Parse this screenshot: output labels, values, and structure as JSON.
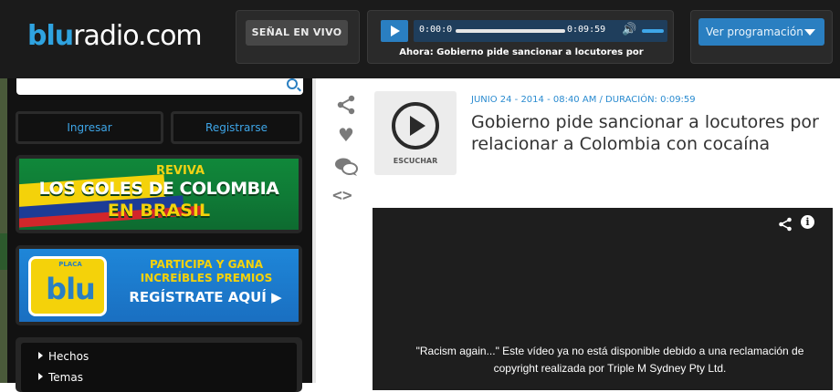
{
  "header": {
    "logo_prefix": "blu",
    "logo_suffix": "radio.com",
    "live_label": "SEÑAL EN VIVO",
    "programming_label": "Ver programación"
  },
  "player": {
    "current_time": "0:00:0",
    "duration": "0:09:59",
    "now_playing": "Ahora: Gobierno pide sancionar a locutores por"
  },
  "sidebar": {
    "login_label": "Ingresar",
    "register_label": "Registrarse",
    "banner1": {
      "line1": "REVIVA",
      "line2": "LOS GOLES DE COLOMBIA",
      "line3": "EN BRASIL"
    },
    "banner2": {
      "badge_top": "PLACA",
      "badge_text": "blu",
      "line1": "PARTICIPA Y GANA",
      "line2": "INCREÍBLES PREMIOS",
      "line3": "REGÍSTRATE AQUÍ ▶"
    },
    "nav": [
      "Hechos",
      "Temas"
    ]
  },
  "article": {
    "listen_label": "ESCUCHAR",
    "meta": "JUNIO 24 - 2014 - 08:40 AM / DURACIÓN: 0:09:59",
    "title": "Gobierno pide sancionar a locutores por relacionar a Colombia con cocaína"
  },
  "video": {
    "message": "\"Racism again...\" Este vídeo ya no está disponible debido a una reclamación de copyright realizada por Triple M Sydney Pty Ltd.",
    "info_glyph": "i"
  },
  "icons": {
    "share": "share-icon",
    "heart": "heart-icon",
    "comment": "comment-icon",
    "embed": "code-icon"
  },
  "colors": {
    "accent_blue": "#2a7fc1",
    "header_bg": "#1b1b1b",
    "link_blue": "#3ea6e8"
  }
}
